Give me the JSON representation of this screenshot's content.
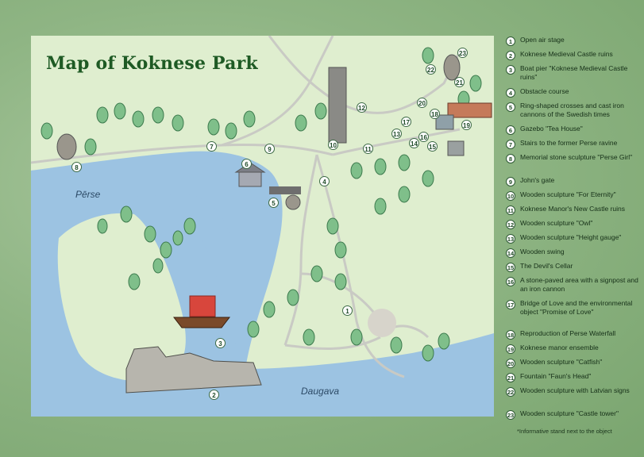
{
  "title": "Map of Koknese Park",
  "places": {
    "perse": "Pērse",
    "daugava": "Daugava"
  },
  "colors": {
    "water": "#9cc3e2",
    "land": "#dfeecf",
    "title": "#1e5a24",
    "path": "#cdcdc9"
  },
  "legend": [
    {
      "num": "1",
      "text": "Open air stage"
    },
    {
      "num": "2",
      "text": "Koknese Medieval Castle ruins"
    },
    {
      "num": "3",
      "text": "Boat pier \"Koknese Medieval Castle ruins\""
    },
    {
      "num": "4",
      "text": "Obstacle course"
    },
    {
      "num": "5",
      "text": "Ring-shaped crosses and cast iron cannons of the Swedish times"
    },
    {
      "num": "6",
      "text": "Gazebo \"Tea House\""
    },
    {
      "num": "7",
      "text": "Stairs to the former Perse ravine"
    },
    {
      "num": "8",
      "text": "Memorial stone sculpture \"Perse Girl\""
    },
    {
      "num": "9",
      "text": "John's gate"
    },
    {
      "num": "10",
      "text": "Wooden sculpture \"For Eternity\""
    },
    {
      "num": "11",
      "text": "Koknese Manor's New Castle ruins"
    },
    {
      "num": "12",
      "text": "Wooden sculpture \"Owl\""
    },
    {
      "num": "13",
      "text": "Wooden sculpture \"Height gauge\""
    },
    {
      "num": "14",
      "text": "Wooden swing"
    },
    {
      "num": "15",
      "text": "The Devil's Cellar"
    },
    {
      "num": "16",
      "text": "A stone-paved area with a signpost and an iron cannon"
    },
    {
      "num": "17",
      "text": "Bridge of Love and the environmental object \"Promise of Love\""
    },
    {
      "num": "18",
      "text": "Reproduction of Perse Waterfall"
    },
    {
      "num": "19",
      "text": "Koknese manor ensemble"
    },
    {
      "num": "20",
      "text": "Wooden sculpture \"Catfish\""
    },
    {
      "num": "21",
      "text": "Fountain \"Faun's Head\""
    },
    {
      "num": "22",
      "text": "Wooden sculpture with Latvian signs"
    },
    {
      "num": "23",
      "text": "Wooden sculpture \"Castle tower\""
    }
  ],
  "footnote": "*Informative stand next to the object"
}
